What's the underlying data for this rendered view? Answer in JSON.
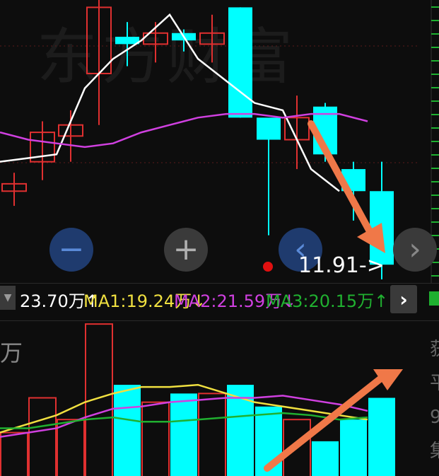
{
  "watermark": "东方财富",
  "price_label": "11.91->",
  "controls": {
    "zoom_out": "−",
    "zoom_in": "+",
    "prev": "‹",
    "next": "›"
  },
  "ma_bar": {
    "dropdown": "▼",
    "volume": "23.70万↑",
    "ma1": "MA1:19.24万↓",
    "ma2": "MA2:21.59万↓",
    "ma3": "MA3:20.15万↑",
    "expand": "›"
  },
  "volume_panel": {
    "unit": "万",
    "side_chars": [
      "获",
      "平",
      "9",
      "集"
    ]
  },
  "colors": {
    "up": "#e03030",
    "down": "#00ffff",
    "ma1": "#f0e040",
    "ma2": "#d040e0",
    "ma3": "#20b030",
    "price_line": "#ffffff",
    "arrow": "#f07848"
  },
  "chart_data": [
    {
      "type": "candlestick",
      "title": "",
      "candles": [
        {
          "open": 10,
          "close": 11,
          "high": 12.5,
          "low": 8,
          "dir": "up"
        },
        {
          "open": 14,
          "close": 18,
          "high": 19.5,
          "low": 11.5,
          "dir": "up"
        },
        {
          "open": 17.5,
          "close": 19,
          "high": 21,
          "low": 14,
          "dir": "up"
        },
        {
          "open": 26,
          "close": 35,
          "high": 36,
          "low": 19,
          "dir": "up"
        },
        {
          "open": 31,
          "close": 30,
          "high": 33,
          "low": 27,
          "dir": "down"
        },
        {
          "open": 30,
          "close": 31.5,
          "high": 33,
          "low": 27.5,
          "dir": "up"
        },
        {
          "open": 31.5,
          "close": 30.5,
          "high": 32,
          "low": 29,
          "dir": "down"
        },
        {
          "open": 30,
          "close": 31.5,
          "high": 34,
          "low": 27.5,
          "dir": "up"
        },
        {
          "open": 35,
          "close": 20,
          "high": 35,
          "low": 20,
          "dir": "down"
        },
        {
          "open": 20,
          "close": 17,
          "high": 19,
          "low": 4,
          "dir": "down"
        },
        {
          "open": 17,
          "close": 20,
          "high": 23,
          "low": 13,
          "dir": "up"
        },
        {
          "open": 21.5,
          "close": 15,
          "high": 22,
          "low": 14,
          "dir": "down"
        },
        {
          "open": 13,
          "close": 10,
          "high": 14,
          "low": 6,
          "dir": "down"
        },
        {
          "open": 10,
          "close": 0,
          "high": 14,
          "low": -2,
          "dir": "down"
        }
      ],
      "price_line": [
        14,
        14.5,
        15,
        24,
        28,
        30.5,
        34,
        28,
        25,
        22,
        21,
        13,
        10
      ],
      "ma_line": [
        18,
        17,
        16.5,
        16,
        16.5,
        18,
        19,
        20,
        20.5,
        20.5,
        20,
        20.5,
        20.5,
        19.5
      ]
    },
    {
      "type": "bar",
      "title": "",
      "values": [
        10,
        18,
        13,
        35,
        21,
        17,
        19,
        19,
        21,
        16,
        13,
        8,
        13,
        18
      ],
      "directions": [
        "up",
        "up",
        "up",
        "up",
        "down",
        "up",
        "down",
        "up",
        "down",
        "down",
        "up",
        "down",
        "down",
        "down"
      ],
      "series": [
        {
          "name": "MA1",
          "values": [
            10,
            12,
            14,
            17,
            19,
            20.5,
            20.5,
            21,
            19,
            17,
            16,
            15,
            14,
            13
          ]
        },
        {
          "name": "MA2",
          "values": [
            9,
            10,
            11,
            13.5,
            15.5,
            16,
            17,
            17.5,
            18,
            18,
            18.5,
            17.5,
            16.5,
            15
          ]
        },
        {
          "name": "MA3",
          "values": [
            11,
            11,
            12,
            13,
            13.5,
            12.5,
            12.5,
            13,
            13.5,
            14,
            14.5,
            14,
            13,
            13.5
          ]
        }
      ]
    }
  ]
}
